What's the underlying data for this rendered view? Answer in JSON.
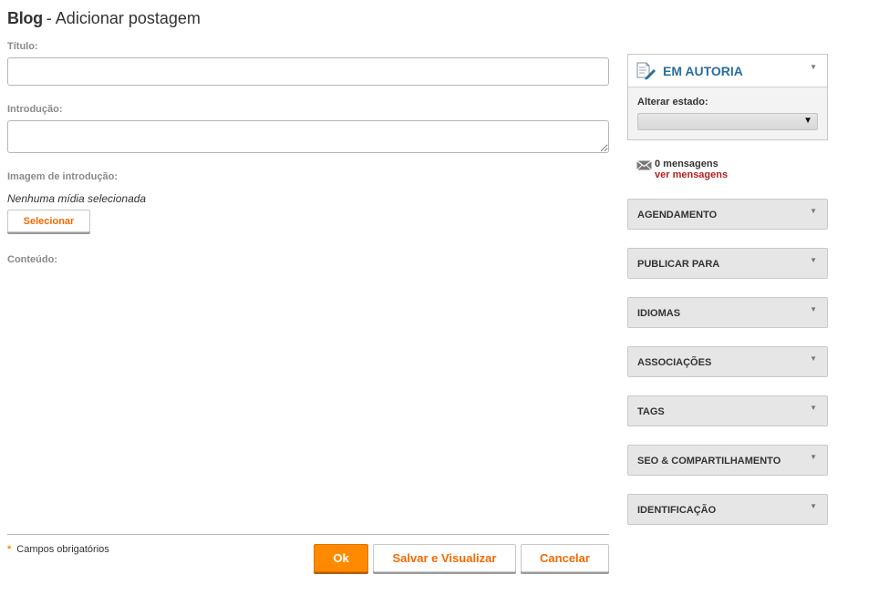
{
  "header": {
    "module": "Blog",
    "separator": "-",
    "title": "Adicionar postagem"
  },
  "form": {
    "title_label": "Título:",
    "title_value": "",
    "intro_label": "Introdução:",
    "intro_value": "",
    "image_label": "Imagem de introdução:",
    "no_media_text": "Nenhuma mídia selecionada",
    "select_button": "Selecionar",
    "content_label": "Conteúdo:"
  },
  "footer": {
    "required_star": "*",
    "required_text": "Campos obrigatórios",
    "ok_button": "Ok",
    "save_view_button": "Salvar e Visualizar",
    "cancel_button": "Cancelar"
  },
  "sidebar": {
    "status_panel": {
      "title": "EM AUTORIA",
      "change_state_label": "Alterar estado:",
      "state_value": "",
      "icon": "document-edit-icon"
    },
    "messages": {
      "count_text": "0 mensagens",
      "link_text": "ver mensagens",
      "icon": "mail-icon"
    },
    "sections": [
      {
        "label": "AGENDAMENTO"
      },
      {
        "label": "PUBLICAR PARA"
      },
      {
        "label": "IDIOMAS"
      },
      {
        "label": "ASSOCIAÇÕES"
      },
      {
        "label": "TAGS"
      },
      {
        "label": "SEO & COMPARTILHAMENTO"
      },
      {
        "label": "IDENTIFICAÇÃO"
      }
    ]
  },
  "colors": {
    "accent": "#ff8a00",
    "button_text": "#f26a00",
    "panel_title": "#2a6ea0",
    "link": "#b22222",
    "panel_bg": "#e6e6e6"
  }
}
